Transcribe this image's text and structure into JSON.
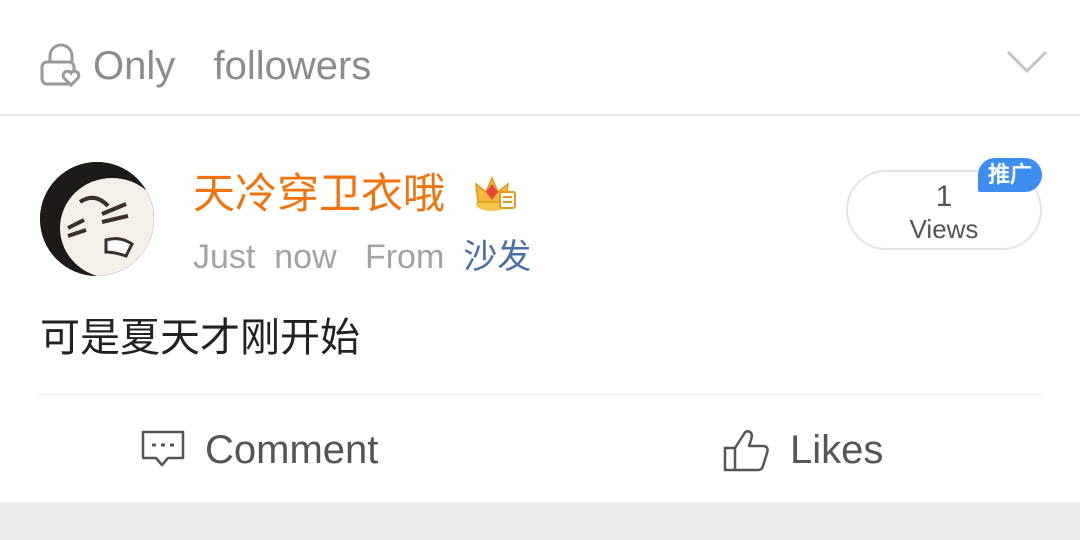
{
  "privacy": {
    "label": "Only  followers",
    "icon": "lock-heart-icon",
    "dropdown_icon": "chevron-down-icon"
  },
  "post": {
    "author": {
      "name": "天冷穿卫衣哦",
      "badge_icon": "crown-icon",
      "avatar": "cartoon-face-avatar"
    },
    "meta": {
      "time": "Just  now",
      "from_label": "From",
      "source": "沙发"
    },
    "views": {
      "count": "1",
      "label": "Views"
    },
    "promo_badge": "推广",
    "text": "可是夏天才刚开始"
  },
  "actions": {
    "comment_label": "Comment",
    "comment_icon": "comment-icon",
    "likes_label": "Likes",
    "likes_icon": "thumbs-up-icon"
  },
  "colors": {
    "username": "#f2720c",
    "source_link": "#4a6fa5",
    "promo_badge": "#3d8ef0",
    "muted_text": "#a3a3a3"
  }
}
